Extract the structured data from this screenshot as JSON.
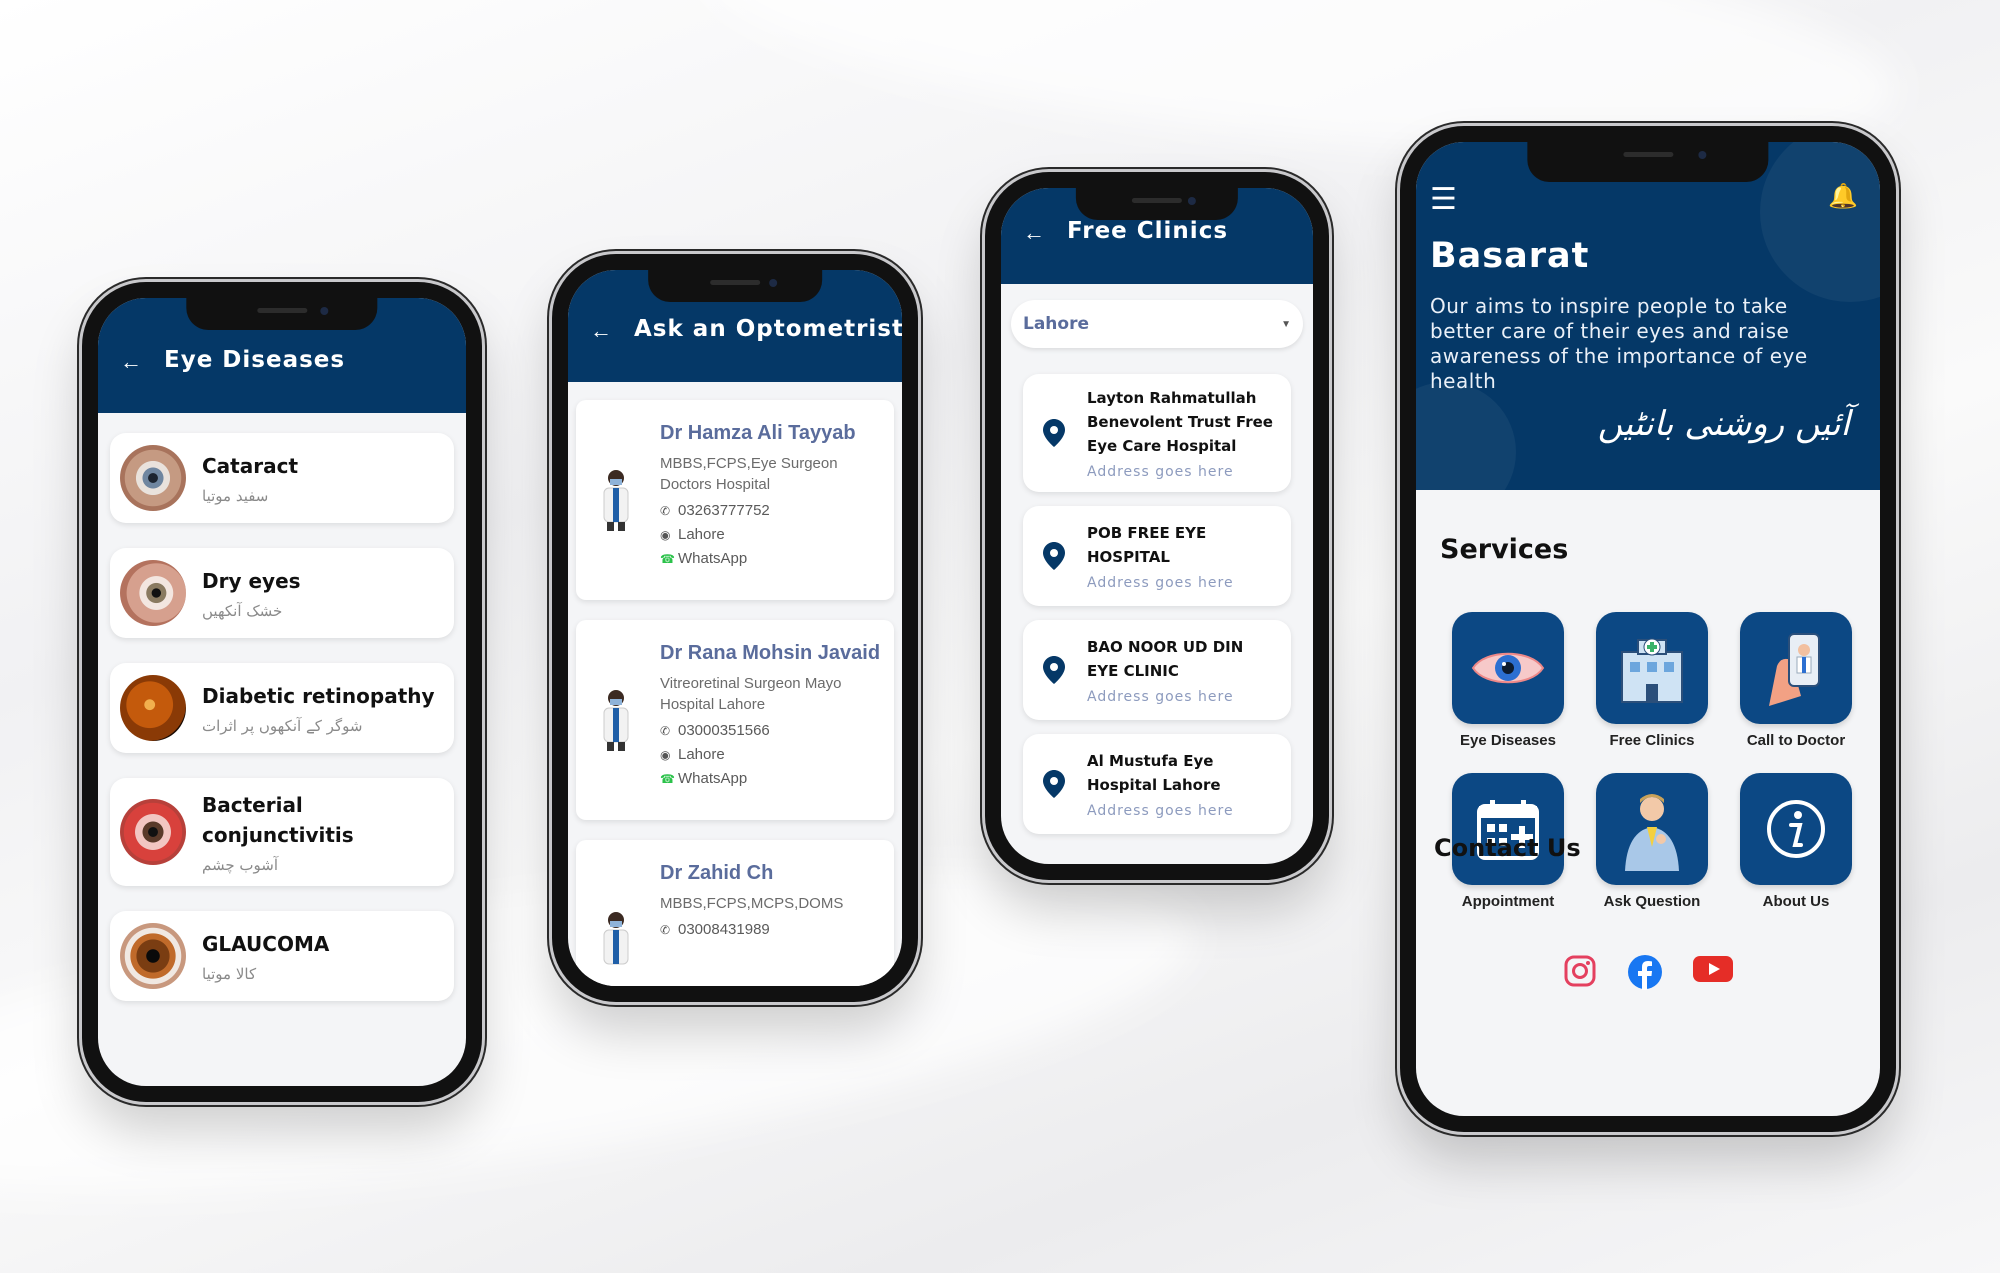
{
  "colors": {
    "primary": "#053867",
    "tile": "#0c4884",
    "link": "#5a6c9c",
    "address": "#8d9bbe"
  },
  "eye_diseases": {
    "back_icon": "arrow-left-icon",
    "title": "Eye Diseases",
    "items": [
      {
        "name": "Cataract",
        "urdu": "سفید موتیا"
      },
      {
        "name": "Dry eyes",
        "urdu": "خشک آنکھیں"
      },
      {
        "name": "Diabetic retinopathy",
        "urdu": "شوگر کے آنکھوں پر اثرات"
      },
      {
        "name": "Bacterial conjunctivitis",
        "urdu": "آشوب چشم"
      },
      {
        "name": "GLAUCOMA",
        "urdu": "کالا موتیا"
      }
    ]
  },
  "optometrist": {
    "back_icon": "arrow-left-icon",
    "title": "Ask an Optometrist",
    "doctors": [
      {
        "name": "Dr Hamza Ali Tayyab",
        "qualification": "MBBS,FCPS,Eye Surgeon Doctors Hospital",
        "phone": "03263777752",
        "city": "Lahore",
        "whatsapp": "WhatsApp"
      },
      {
        "name": "Dr Rana Mohsin Javaid",
        "qualification": "Vitreoretinal Surgeon Mayo Hospital Lahore",
        "phone": "03000351566",
        "city": "Lahore",
        "whatsapp": "WhatsApp"
      },
      {
        "name": "Dr Zahid Ch",
        "qualification": "MBBS,FCPS,MCPS,DOMS",
        "phone": "03008431989",
        "city": "",
        "whatsapp": ""
      }
    ]
  },
  "clinics": {
    "back_icon": "arrow-left-icon",
    "title": "Free Clinics",
    "city_select": "Lahore",
    "items": [
      {
        "name": "Layton Rahmatullah Benevolent Trust Free Eye Care Hospital",
        "address": "Address goes here"
      },
      {
        "name": "POB FREE EYE HOSPITAL",
        "address": "Address goes here"
      },
      {
        "name": "BAO NOOR UD DIN EYE CLINIC",
        "address": "Address goes here"
      },
      {
        "name": "Al Mustufa Eye Hospital Lahore",
        "address": "Address goes here"
      }
    ]
  },
  "home": {
    "menu_icon": "hamburger-menu-icon",
    "bell_icon": "bell-icon",
    "title": "Basarat",
    "tagline": "Our aims to inspire people to take better care of their eyes and raise awareness of the importance of eye health",
    "urdu_tagline": "آئیں روشنی بانٹیں",
    "services_heading": "Services",
    "services": [
      {
        "label": "Eye Diseases",
        "icon": "eye-icon"
      },
      {
        "label": "Free Clinics",
        "icon": "hospital-icon"
      },
      {
        "label": "Call to Doctor",
        "icon": "phone-doctor-icon"
      },
      {
        "label": "Appointment",
        "icon": "calendar-icon"
      },
      {
        "label": "Ask Question",
        "icon": "thinking-person-icon"
      },
      {
        "label": "About Us",
        "icon": "info-icon"
      }
    ],
    "contact_heading": "Contact Us",
    "social": [
      {
        "name": "Instagram",
        "icon": "instagram-icon",
        "color": "#e4405f"
      },
      {
        "name": "Facebook",
        "icon": "facebook-icon",
        "color": "#1877f2"
      },
      {
        "name": "YouTube",
        "icon": "youtube-icon",
        "color": "#e52d27"
      }
    ]
  }
}
